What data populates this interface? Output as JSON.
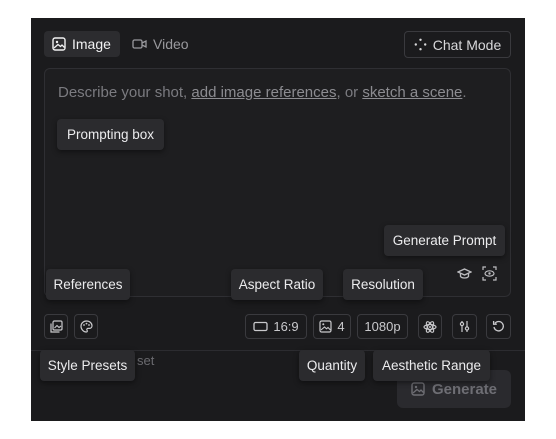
{
  "mode_tabs": {
    "image_label": "Image",
    "video_label": "Video"
  },
  "chat_mode": {
    "label": "Chat Mode"
  },
  "prompt": {
    "text_before": "Describe your shot, ",
    "link_references": "add image references",
    "text_middle": ", or ",
    "link_sketch": "sketch a scene",
    "text_after": "."
  },
  "toolbar": {
    "aspect_ratio": "16:9",
    "quantity": "4",
    "resolution": "1080p"
  },
  "hidden_text": "set",
  "generate": {
    "label": "Generate"
  },
  "tooltips": {
    "prompting_box": "Prompting box",
    "generate_prompt": "Generate Prompt",
    "references": "References",
    "aspect_ratio": "Aspect Ratio",
    "resolution": "Resolution",
    "style_presets": "Style Presets",
    "quantity": "Quantity",
    "aesthetic_range": "Aesthetic Range"
  },
  "icons": {
    "image_tab": "image-icon",
    "video_tab": "video-camera-icon",
    "chat_mode": "sparkle-icon",
    "generate_prompt": "graduation-cap-icon",
    "prompt_scan": "scan-eye-icon",
    "references": "image-reference-icon",
    "style_presets": "palette-icon",
    "aspect": "rectangle-icon",
    "quantity": "image-icon",
    "aesthetic": "atom-icon",
    "settings": "sliders-icon",
    "reset": "refresh-icon",
    "generate": "image-icon"
  },
  "colors": {
    "panel_bg": "#1b1b1d",
    "tooltip_bg": "#2b2b2e",
    "text_primary": "#f1f1f2"
  }
}
